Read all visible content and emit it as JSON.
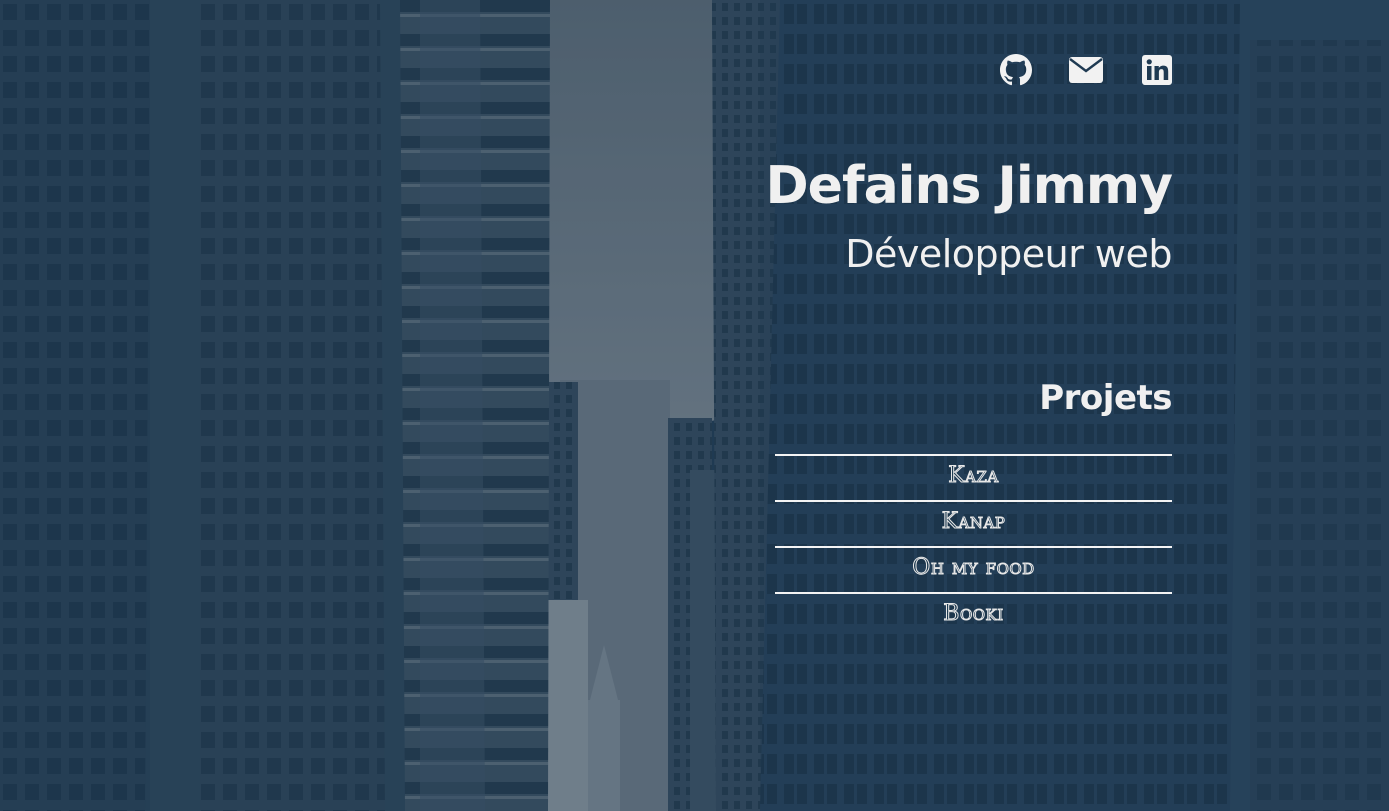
{
  "colors": {
    "overlay": "#1f3a52",
    "text": "#f0f0f0",
    "divider": "#f4f4f4"
  },
  "socials": [
    {
      "icon": "github-icon",
      "label": "GitHub"
    },
    {
      "icon": "mail-icon",
      "label": "Email"
    },
    {
      "icon": "linkedin-icon",
      "label": "LinkedIn"
    }
  ],
  "header": {
    "name": "Defains Jimmy",
    "role": "Développeur web"
  },
  "projects": {
    "title": "Projets",
    "items": [
      {
        "label": "Kaza"
      },
      {
        "label": "Kanap"
      },
      {
        "label": "Oh my food"
      },
      {
        "label": "Booki"
      }
    ]
  }
}
